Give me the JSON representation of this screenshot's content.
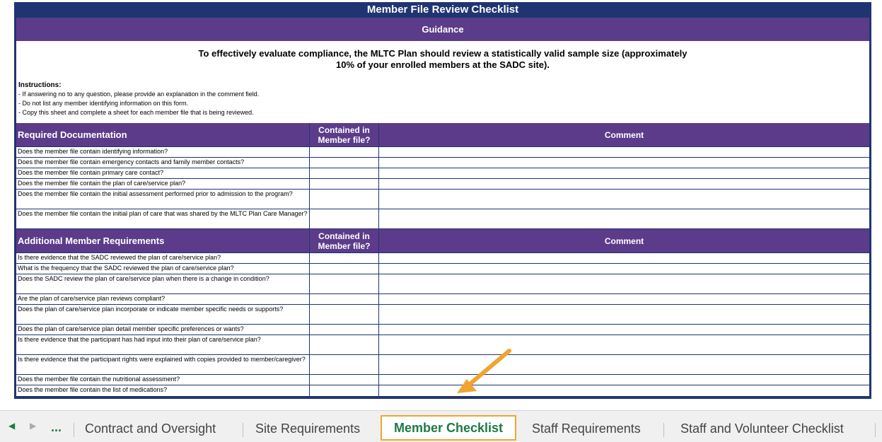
{
  "sheet": {
    "title": "Member File Review Checklist",
    "guidance": "Guidance",
    "intro_line1": "To effectively evaluate compliance, the MLTC Plan should review a statistically valid sample size (approximately",
    "intro_line2": "10% of your enrolled members at the SADC site).",
    "instructions_heading": "Instructions:",
    "instructions": [
      "- If answering no to any question, please provide an explanation in the comment field.",
      "- Do not list any member identifying information on this form.",
      "- Copy this sheet and complete a sheet for each member file that is being reviewed."
    ],
    "section1": {
      "title": "Required Documentation",
      "col2": "Contained in Member file?",
      "col3": "Comment",
      "rows": [
        "Does the member file contain identifying information?",
        "Does the member file contain emergency contacts and family member contacts?",
        "Does the member file contain primary care contact?",
        "Does the member file contain the plan of care/service plan?",
        "Does the member file contain the initial assessment performed prior to admission to the program?",
        "Does the member file contain the initial plan of care that was shared by the MLTC Plan Care Manager?"
      ]
    },
    "section2": {
      "title": "Additional Member Requirements",
      "col2": "Contained in Member file?",
      "col3": "Comment",
      "rows": [
        "Is there evidence that the SADC reviewed the plan of care/service plan?",
        "What is the frequency that the SADC reviewed the plan of care/service plan?",
        "Does the SADC review the plan of care/service plan when there is a change in condition?",
        "Are the plan of care/service plan reviews compliant?",
        "Does the plan of care/service plan incorporate or indicate member specific needs or supports?",
        "Does the plan of care/service plan detail member specific preferences or wants?",
        "Is there evidence that the participant has had input into their plan of care/service plan?",
        "Is there evidence that the participant rights were explained with copies provided to member/caregiver?",
        "Does the member file contain the nutritional assessment?",
        "Does the member file contain the list of medications?"
      ]
    }
  },
  "tabs": {
    "nav_prev": "◀",
    "nav_next": "▶",
    "more": "...",
    "items": [
      "Contract and Oversight",
      "Site Requirements",
      "Member Checklist",
      "Staff Requirements",
      "Staff and Volunteer Checklist"
    ],
    "active": "Member Checklist"
  },
  "colors": {
    "frame": "#1f3572",
    "header": "#5c3c8a",
    "active_tab_text": "#1e7a46",
    "active_tab_border": "#f0a530",
    "arrow": "#f0a530"
  },
  "icons": {
    "callout": "arrow-callout-icon",
    "scroll_left": "scroll-left-icon",
    "scroll_right": "scroll-right-icon"
  }
}
